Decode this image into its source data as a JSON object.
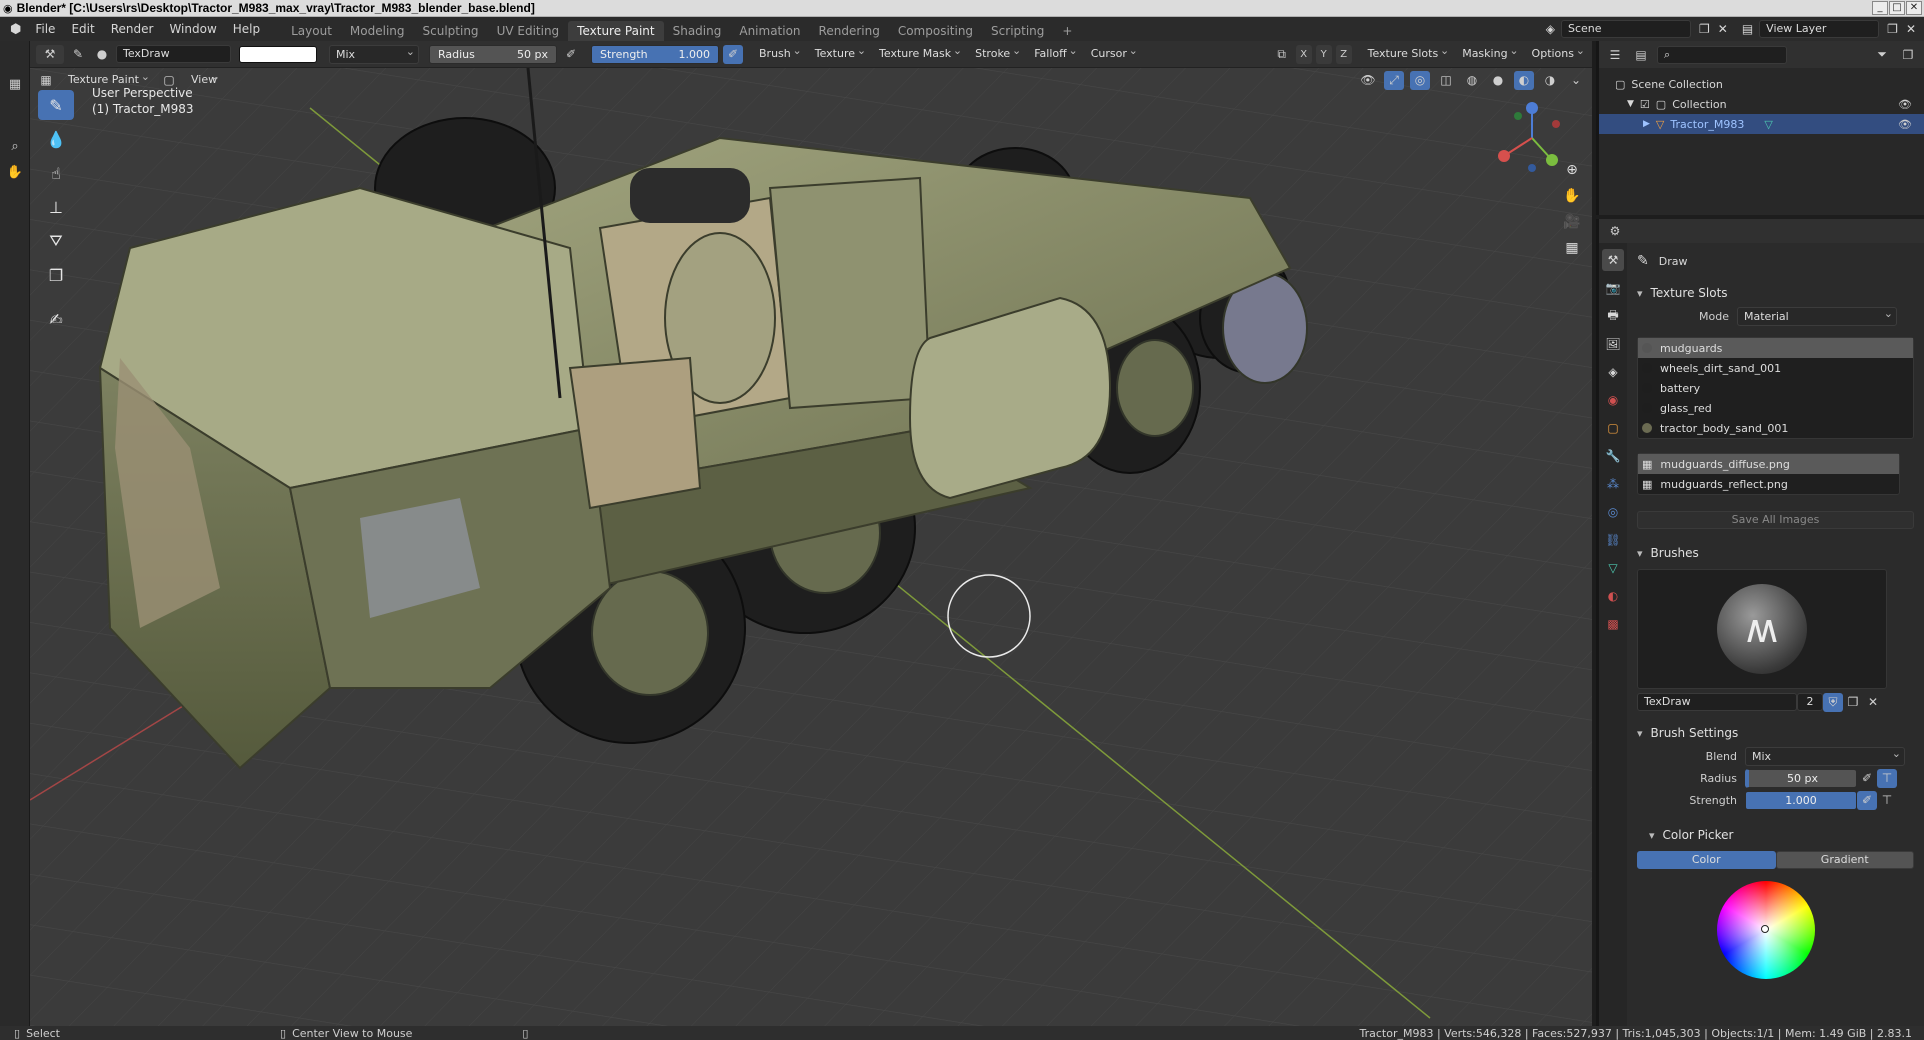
{
  "window": {
    "title": "Blender* [C:\\Users\\rs\\Desktop\\Tractor_M983_max_vray\\Tractor_M983_blender_base.blend]"
  },
  "menu": {
    "items": [
      "File",
      "Edit",
      "Render",
      "Window",
      "Help"
    ],
    "workspaces": [
      "Layout",
      "Modeling",
      "Sculpting",
      "UV Editing",
      "Texture Paint",
      "Shading",
      "Animation",
      "Rendering",
      "Compositing",
      "Scripting"
    ],
    "active_workspace": "Texture Paint",
    "scene": "Scene",
    "view_layer": "View Layer"
  },
  "toolheader": {
    "brush_name": "TexDraw",
    "blend": "Mix",
    "radius_label": "Radius",
    "radius_value": "50 px",
    "strength_label": "Strength",
    "strength_value": "1.000",
    "strength_fraction": 1.0,
    "menus": [
      "Brush",
      "Texture",
      "Texture Mask",
      "Stroke",
      "Falloff",
      "Cursor"
    ],
    "axis": [
      "X",
      "Y",
      "Z"
    ],
    "right_menus": [
      "Texture Slots",
      "Masking",
      "Options"
    ],
    "brush_color": "#ffffff"
  },
  "viewport_header": {
    "mode": "Texture Paint",
    "view": "View"
  },
  "viewport": {
    "perspective": "User Perspective",
    "object": "(1) Tractor_M983"
  },
  "outliner": {
    "scene_collection": "Scene Collection",
    "collection": "Collection",
    "object": "Tractor_M983"
  },
  "properties": {
    "tool": "Draw",
    "texture_slots": {
      "title": "Texture Slots",
      "mode_label": "Mode",
      "mode_value": "Material",
      "materials": [
        {
          "name": "mudguards",
          "color": "#555555"
        },
        {
          "name": "wheels_dirt_sand_001",
          "color": "#1e1e1e"
        },
        {
          "name": "battery",
          "color": "#1e1e1e"
        },
        {
          "name": "glass_red",
          "color": "#1e1e1e"
        },
        {
          "name": "tractor_body_sand_001",
          "color": "#6b6b52"
        }
      ],
      "images": [
        "mudguards_diffuse.png",
        "mudguards_reflect.png"
      ],
      "save_all": "Save All Images"
    },
    "brushes": {
      "title": "Brushes",
      "name": "TexDraw",
      "users": "2"
    },
    "brush_settings": {
      "title": "Brush Settings",
      "blend_label": "Blend",
      "blend_value": "Mix",
      "radius_label": "Radius",
      "radius_value": "50 px",
      "strength_label": "Strength",
      "strength_value": "1.000"
    },
    "color_picker": {
      "title": "Color Picker",
      "tabs": [
        "Color",
        "Gradient"
      ],
      "active_tab": "Color"
    }
  },
  "status": {
    "select": "Select",
    "center_view": "Center View to Mouse",
    "stats": "Tractor_M983 | Verts:546,328 | Faces:527,937 | Tris:1,045,303 | Objects:1/1 | Mem: 1.49 GiB | 2.83.1"
  },
  "colors": {
    "accent": "#4772b3",
    "selection": "#334d80",
    "vehicle": "#8a8a66"
  }
}
